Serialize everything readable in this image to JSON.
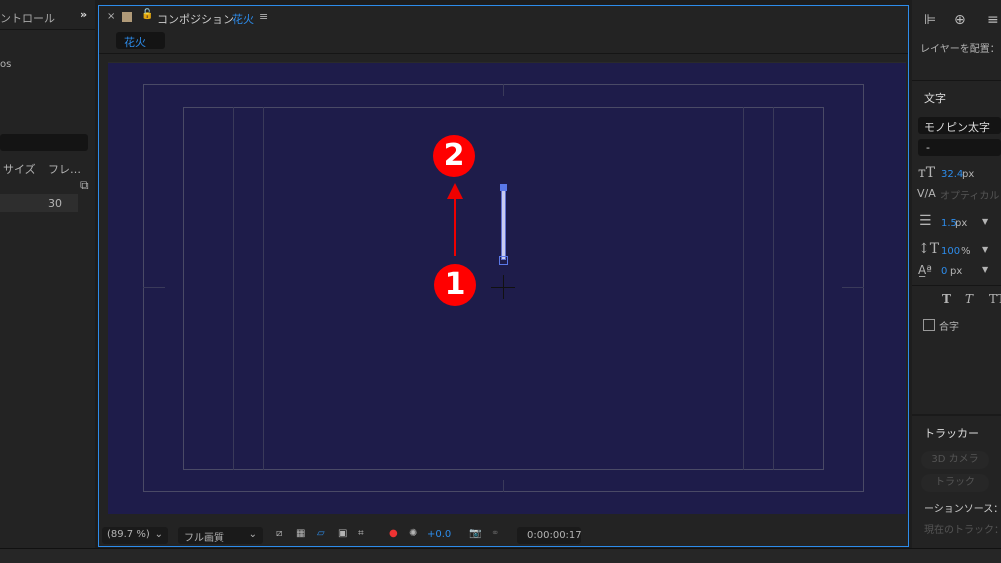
{
  "left_panel": {
    "tab_label": "ントロール",
    "fps_suffix": "os",
    "columns": [
      "サイズ",
      "フレ…"
    ],
    "row_value": "30"
  },
  "comp_panel": {
    "title": "コンポジション",
    "comp_name": "花火",
    "tab": "花火",
    "swatch_color": "#b09a78",
    "accent": "#2d8ceb",
    "bg_color": "#1e1c4a"
  },
  "viewer": {
    "annotations": [
      {
        "label": "1"
      },
      {
        "label": "2"
      }
    ],
    "annotation_color": "#ff0000"
  },
  "footer": {
    "zoom": "(89.7 %)",
    "quality": "フル画質",
    "exposure": "+0.0",
    "timecode": "0:00:00:17"
  },
  "right_panel": {
    "align_label": "レイヤーを配置：",
    "char_heading": "文字",
    "font": "モノピン太字",
    "style": "-",
    "font_size": "32.4",
    "font_size_unit": "px",
    "kerning": "オプティカル",
    "stroke": "1.5",
    "stroke_unit": "px",
    "vscale": "100",
    "vscale_unit": "%",
    "baseline": "0",
    "baseline_unit": "px",
    "ligature": "合字",
    "tracker_heading": "トラッカー",
    "btn_3d": "3D カメラ",
    "btn_track": "トラック",
    "motion_source": "ーションソース：",
    "current_track": "現在のトラック："
  }
}
